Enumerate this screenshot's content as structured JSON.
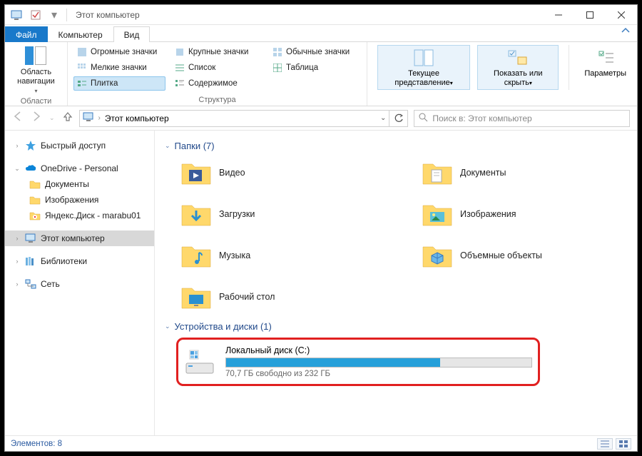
{
  "window": {
    "title": "Этот компьютер"
  },
  "tabs": {
    "file": "Файл",
    "computer": "Компьютер",
    "view": "Вид"
  },
  "ribbon": {
    "panes_group": "Области",
    "nav_pane": "Область навигации",
    "layout_group": "Структура",
    "layouts": {
      "huge": "Огромные значки",
      "large": "Крупные значки",
      "normal": "Обычные значки",
      "small": "Мелкие значки",
      "list": "Список",
      "table": "Таблица",
      "tile": "Плитка",
      "content": "Содержимое"
    },
    "current_view": "Текущее представление",
    "show_hide": "Показать или скрыть",
    "options": "Параметры"
  },
  "address": {
    "location": "Этот компьютер"
  },
  "search": {
    "placeholder": "Поиск в: Этот компьютер"
  },
  "tree": {
    "quick": "Быстрый доступ",
    "onedrive": "OneDrive - Personal",
    "od_docs": "Документы",
    "od_images": "Изображения",
    "yadisk": "Яндекс.Диск - marabu01",
    "this_pc": "Этот компьютер",
    "libraries": "Библиотеки",
    "network": "Сеть"
  },
  "sections": {
    "folders": "Папки (7)",
    "devices": "Устройства и диски (1)"
  },
  "folders": {
    "video": "Видео",
    "documents": "Документы",
    "downloads": "Загрузки",
    "images": "Изображения",
    "music": "Музыка",
    "objects3d": "Объемные объекты",
    "desktop": "Рабочий стол"
  },
  "drive": {
    "name": "Локальный диск (C:)",
    "free_text": "70,7 ГБ свободно из 232 ГБ",
    "used_pct": 70
  },
  "status": {
    "elements": "Элементов: 8"
  }
}
